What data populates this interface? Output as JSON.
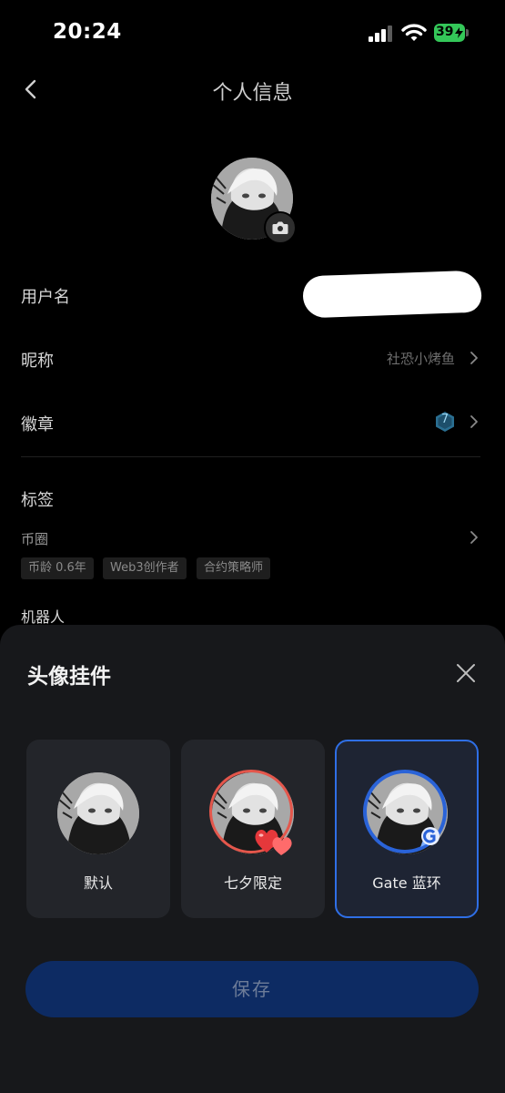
{
  "status_bar": {
    "time": "20:24",
    "battery": "39"
  },
  "header": {
    "title": "个人信息"
  },
  "profile": {
    "username_label": "用户名",
    "nickname_label": "昵称",
    "nickname_value": "社恐小烤鱼",
    "badge_label": "徽章",
    "badge_count": "7",
    "tags_label": "标签",
    "coin_circle_label": "币圈",
    "chips": [
      "币龄 0.6年",
      "Web3创作者",
      "合约策略师"
    ],
    "robot_label": "机器人"
  },
  "sheet": {
    "title": "头像挂件",
    "options": [
      {
        "label": "默认"
      },
      {
        "label": "七夕限定"
      },
      {
        "label": "Gate 蓝环"
      }
    ],
    "selected": "Gate 蓝环",
    "save_label": "保存"
  },
  "colors": {
    "accent_blue": "#2f6fe6",
    "save_button_bg": "#0d2b63",
    "ring_red": "#e4574c",
    "battery_green": "#34c759"
  }
}
